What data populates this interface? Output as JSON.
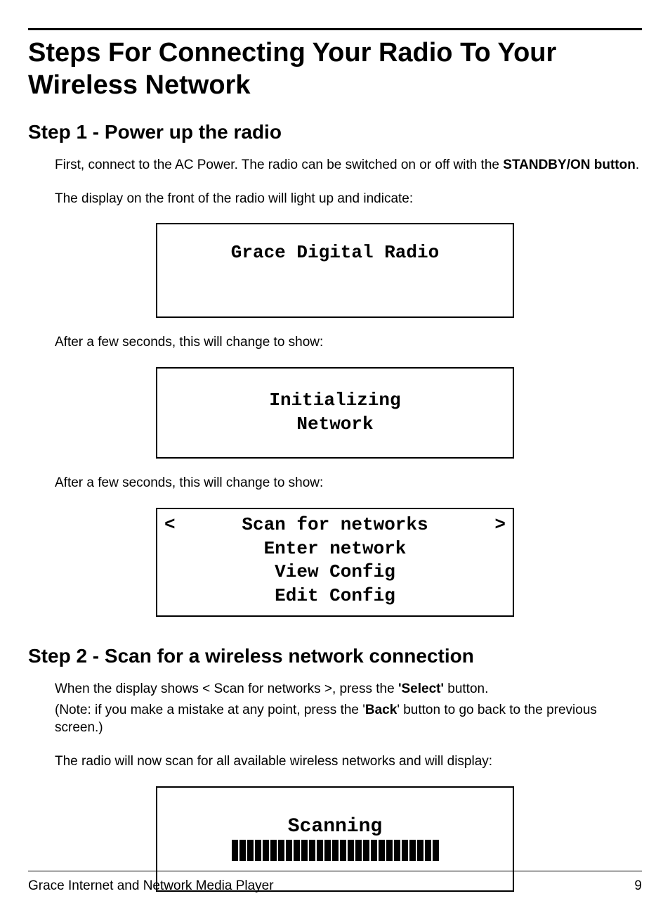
{
  "page": {
    "title": "Steps For Connecting Your Radio To Your Wireless Network",
    "step1": {
      "heading": "Step 1 - Power up the radio",
      "p1_a": "First, connect to the AC Power. The radio can be switched on or off with the ",
      "p1_b": "STANDBY/ON button",
      "p1_c": ".",
      "p2": "The display on the front of the radio will light up and indicate:",
      "display1": "Grace Digital Radio",
      "p3": "After a few seconds, this will change to show:",
      "display2_l1": "Initializing",
      "display2_l2": "Network",
      "p4": "After a few seconds, this will change to show:",
      "menu": {
        "item1": "Scan for networks",
        "item2": "Enter network",
        "item3": "View Config",
        "item4": "Edit Config",
        "left": "<",
        "right": ">"
      }
    },
    "step2": {
      "heading": "Step 2 - Scan for a wireless network connection",
      "p1_a": "When the display shows < Scan for networks >, press the ",
      "p1_b": "'Select'",
      "p1_c": " button.",
      "p2_a": "(Note: if you make a mistake at any point, press the '",
      "p2_b": "Back",
      "p2_c": "' button to go back to the previous screen.)",
      "p3": "The radio will now scan for all available wireless networks and will display:",
      "scanning": "Scanning"
    },
    "footer": {
      "left": "Grace Internet and Network Media Player",
      "right": "9"
    }
  }
}
